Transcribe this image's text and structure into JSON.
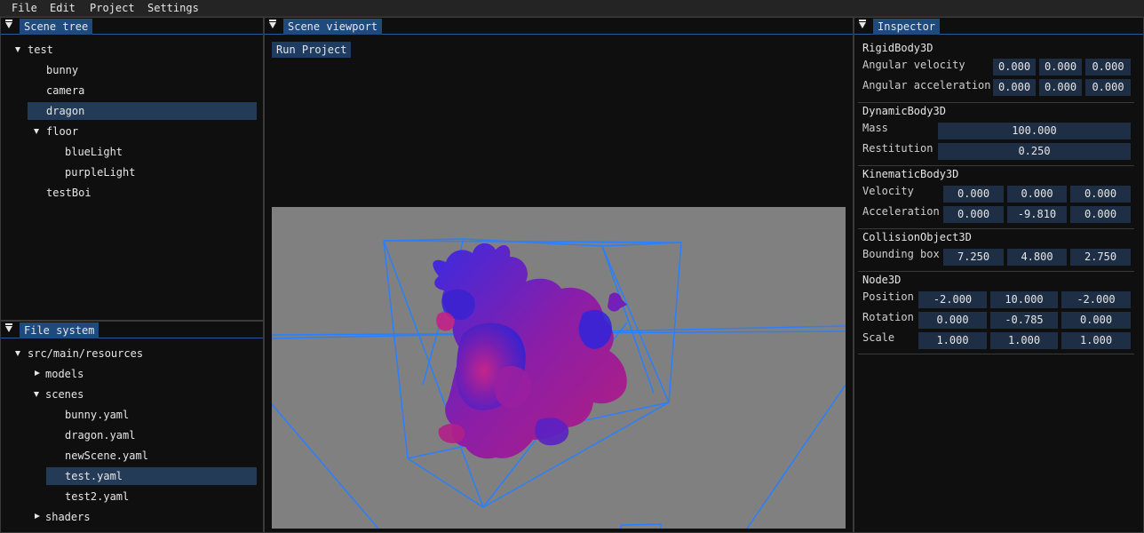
{
  "menubar": {
    "items": [
      "File",
      "Edit",
      "Project",
      "Settings"
    ]
  },
  "scene_tree": {
    "title": "Scene tree",
    "items": [
      {
        "label": "test",
        "expanded": true,
        "selected": false
      },
      {
        "label": "bunny",
        "selected": false
      },
      {
        "label": "camera",
        "selected": false
      },
      {
        "label": "dragon",
        "selected": true
      },
      {
        "label": "floor",
        "expanded": true,
        "selected": false
      },
      {
        "label": "blueLight",
        "selected": false
      },
      {
        "label": "purpleLight",
        "selected": false
      },
      {
        "label": "testBoi",
        "selected": false
      }
    ]
  },
  "file_system": {
    "title": "File system",
    "items": [
      {
        "label": "src/main/resources",
        "expanded": true
      },
      {
        "label": "models",
        "expanded": false
      },
      {
        "label": "scenes",
        "expanded": true
      },
      {
        "label": "bunny.yaml"
      },
      {
        "label": "dragon.yaml"
      },
      {
        "label": "newScene.yaml"
      },
      {
        "label": "test.yaml",
        "selected": true
      },
      {
        "label": "test2.yaml"
      },
      {
        "label": "shaders",
        "expanded": false
      }
    ]
  },
  "scene_viewport": {
    "title": "Scene viewport",
    "run_button": "Run Project",
    "background_color": "#808080",
    "wireframe_color": "#2a7fff"
  },
  "inspector": {
    "title": "Inspector",
    "rigidbody": {
      "title": "RigidBody3D",
      "angular_velocity": {
        "label": "Angular velocity",
        "values": [
          "0.000",
          "0.000",
          "0.000"
        ]
      },
      "angular_acceleration": {
        "label": "Angular acceleration",
        "values": [
          "0.000",
          "0.000",
          "0.000"
        ]
      }
    },
    "dynamicbody": {
      "title": "DynamicBody3D",
      "mass": {
        "label": "Mass",
        "value": "100.000"
      },
      "restitution": {
        "label": "Restitution",
        "value": "0.250"
      }
    },
    "kinematicbody": {
      "title": "KinematicBody3D",
      "velocity": {
        "label": "Velocity",
        "values": [
          "0.000",
          "0.000",
          "0.000"
        ]
      },
      "acceleration": {
        "label": "Acceleration",
        "values": [
          "0.000",
          "-9.810",
          "0.000"
        ]
      }
    },
    "collisionobject": {
      "title": "CollisionObject3D",
      "bounding_box": {
        "label": "Bounding box",
        "values": [
          "7.250",
          "4.800",
          "2.750"
        ]
      }
    },
    "node3d": {
      "title": "Node3D",
      "position": {
        "label": "Position",
        "values": [
          "-2.000",
          "10.000",
          "-2.000"
        ]
      },
      "rotation": {
        "label": "Rotation",
        "values": [
          "0.000",
          "-0.785",
          "0.000"
        ]
      },
      "scale": {
        "label": "Scale",
        "values": [
          "1.000",
          "1.000",
          "1.000"
        ]
      }
    }
  },
  "colors": {
    "accent_tab": "#1f4a7e",
    "selection": "#243b58",
    "field_bg": "#1e2f45",
    "button_bg": "#1e3c61"
  }
}
